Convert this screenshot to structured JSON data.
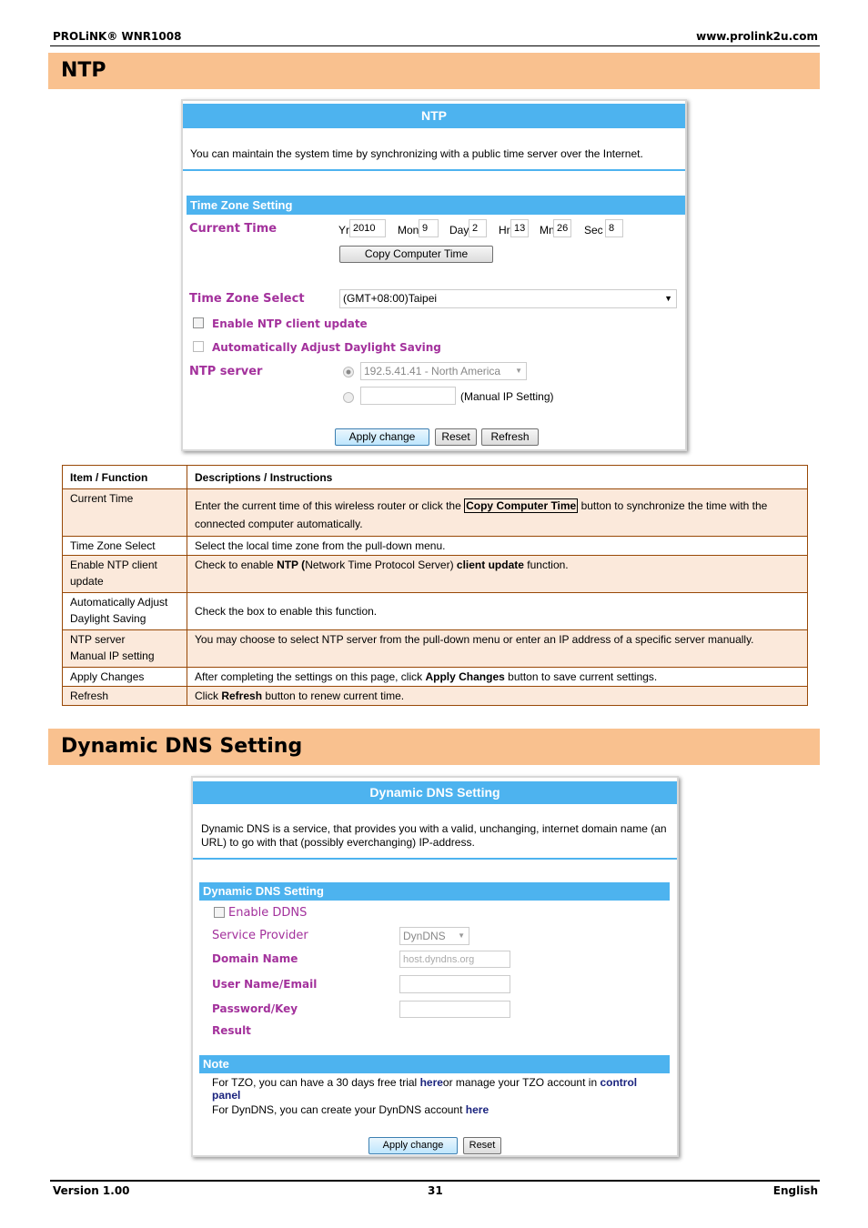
{
  "header": {
    "left": "PROLiNK® WNR1008",
    "right": "www.prolink2u.com"
  },
  "ntp_section": {
    "title": "NTP"
  },
  "ntp_panel": {
    "title": "NTP",
    "description": "You can maintain the system time by synchronizing with a public time server over the Internet.",
    "tz_bar": "Time Zone Setting",
    "current_time_label": "Current Time",
    "time_fields": [
      {
        "label": "Yr",
        "value": "2010"
      },
      {
        "label": "Mon",
        "value": "9"
      },
      {
        "label": "Day",
        "value": "2"
      },
      {
        "label": "Hr",
        "value": "13"
      },
      {
        "label": "Mn",
        "value": "26"
      },
      {
        "label": "Sec",
        "value": "8"
      }
    ],
    "copy_button": "Copy Computer Time",
    "tz_select_label": "Time Zone Select",
    "tz_select_value": "(GMT+08:00)Taipei",
    "enable_ntp_label": "Enable NTP client update",
    "enable_ntp_checked": false,
    "daylight_label": "Automatically Adjust Daylight Saving",
    "daylight_checked": false,
    "ntp_server_label": "NTP server",
    "ntp_server_value": "192.5.41.41 - North America",
    "manual_ip_value": "",
    "manual_ip_label": "(Manual IP Setting)",
    "apply_button": "Apply change",
    "reset_button": "Reset",
    "refresh_button": "Refresh"
  },
  "table": {
    "headers": [
      "Item / Function",
      "Descriptions / Instructions"
    ],
    "rows": [
      {
        "item": "Current Time",
        "desc": [
          "Enter the current time of this wireless router or click the ",
          "Copy Computer Time",
          " button to synchronize the time with the connected computer automatically."
        ]
      },
      {
        "item": "Time Zone Select",
        "desc": [
          "Select the local time zone from the pull-down menu."
        ]
      },
      {
        "item": "Enable NTP client update",
        "desc": [
          "Check to enable ",
          "NTP (",
          "Network Time Protocol Server) ",
          "client update",
          " function."
        ]
      },
      {
        "item": "Automatically Adjust Daylight Saving",
        "desc": [
          "Check the box to enable this function."
        ]
      },
      {
        "item": "NTP server",
        "item2": "Manual IP setting",
        "desc": [
          "You may choose to select NTP server from the pull-down menu or enter an IP address of a specific server manually."
        ]
      },
      {
        "item": "Apply Changes",
        "desc": [
          "After completing the settings on this page, click ",
          "Apply Changes",
          " button to save current settings."
        ]
      },
      {
        "item": "Refresh",
        "desc": [
          "Click ",
          "Refresh",
          " button to renew current time."
        ]
      }
    ]
  },
  "ddns_section": {
    "title": "Dynamic DNS Setting"
  },
  "ddns_panel": {
    "title": "Dynamic DNS Setting",
    "description": "Dynamic DNS is a service, that provides you with a valid, unchanging, internet domain name (an URL) to go with that (possibly everchanging) IP-address.",
    "bar": "Dynamic DNS Setting",
    "enable_label": "Enable DDNS",
    "enable_checked": false,
    "provider_label": "Service Provider",
    "provider_value": "DynDNS",
    "domain_label": "Domain Name",
    "domain_value": "host.dyndns.org",
    "user_label": "User Name/Email",
    "user_value": "",
    "password_label": "Password/Key",
    "password_value": "",
    "result_label": "Result",
    "note_bar": "Note",
    "note1": [
      "For TZO, you can have a 30 days free trial ",
      "here",
      "or manage your TZO account in ",
      "control panel"
    ],
    "note2": [
      "For DynDNS, you can create your DynDNS account ",
      "here"
    ],
    "apply_button": "Apply change",
    "reset_button": "Reset"
  },
  "footer": {
    "left": "Version 1.00",
    "center": "31",
    "right": "English"
  },
  "colors": {
    "section_bar": "#f9c18f",
    "panel_blue": "#4db3ef",
    "label_purple": "#a3319c",
    "table_border": "#984806",
    "row_shade": "#fbe9db"
  }
}
